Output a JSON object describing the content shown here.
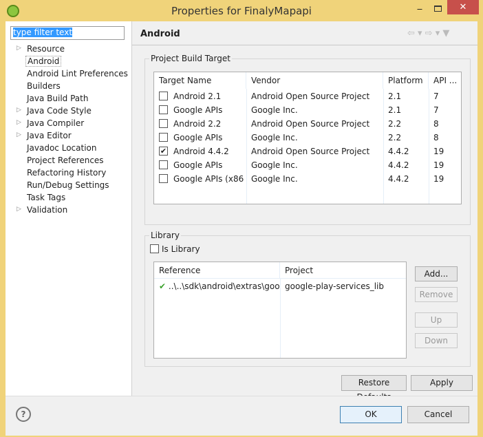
{
  "window": {
    "title": "Properties for FinalyMapapi",
    "minimize": "‒",
    "close": "✕"
  },
  "filter": {
    "value": "type filter text"
  },
  "tree": [
    {
      "label": "Resource",
      "expandable": true
    },
    {
      "label": "Android",
      "expandable": false,
      "selected": true
    },
    {
      "label": "Android Lint Preferences",
      "expandable": false
    },
    {
      "label": "Builders",
      "expandable": false
    },
    {
      "label": "Java Build Path",
      "expandable": false
    },
    {
      "label": "Java Code Style",
      "expandable": true
    },
    {
      "label": "Java Compiler",
      "expandable": true
    },
    {
      "label": "Java Editor",
      "expandable": true
    },
    {
      "label": "Javadoc Location",
      "expandable": false
    },
    {
      "label": "Project References",
      "expandable": false
    },
    {
      "label": "Refactoring History",
      "expandable": false
    },
    {
      "label": "Run/Debug Settings",
      "expandable": false
    },
    {
      "label": "Task Tags",
      "expandable": false
    },
    {
      "label": "Validation",
      "expandable": true
    }
  ],
  "page": {
    "title": "Android",
    "nav_icons": "⇦ ▾ ⇨ ▾ ▼"
  },
  "build_target": {
    "group_label": "Project Build Target",
    "columns": [
      "Target Name",
      "Vendor",
      "Platform",
      "API ..."
    ],
    "rows": [
      {
        "name": "Android 2.1",
        "vendor": "Android Open Source Project",
        "platform": "2.1",
        "api": "7",
        "checked": false
      },
      {
        "name": "Google APIs",
        "vendor": "Google Inc.",
        "platform": "2.1",
        "api": "7",
        "checked": false
      },
      {
        "name": "Android 2.2",
        "vendor": "Android Open Source Project",
        "platform": "2.2",
        "api": "8",
        "checked": false
      },
      {
        "name": "Google APIs",
        "vendor": "Google Inc.",
        "platform": "2.2",
        "api": "8",
        "checked": false
      },
      {
        "name": "Android 4.4.2",
        "vendor": "Android Open Source Project",
        "platform": "4.4.2",
        "api": "19",
        "checked": true
      },
      {
        "name": "Google APIs",
        "vendor": "Google Inc.",
        "platform": "4.4.2",
        "api": "19",
        "checked": false
      },
      {
        "name": "Google APIs (x86 ...",
        "vendor": "Google Inc.",
        "platform": "4.4.2",
        "api": "19",
        "checked": false
      }
    ]
  },
  "library": {
    "group_label": "Library",
    "is_library_label": "Is Library",
    "columns": [
      "Reference",
      "Project"
    ],
    "rows": [
      {
        "reference": "..\\..\\sdk\\android\\extras\\goo...",
        "project": "google-play-services_lib",
        "status": "ok"
      }
    ],
    "buttons": {
      "add": "Add...",
      "remove": "Remove",
      "up": "Up",
      "down": "Down"
    }
  },
  "buttons": {
    "restore": "Restore Defaults",
    "apply": "Apply",
    "ok": "OK",
    "cancel": "Cancel",
    "help": "?"
  }
}
